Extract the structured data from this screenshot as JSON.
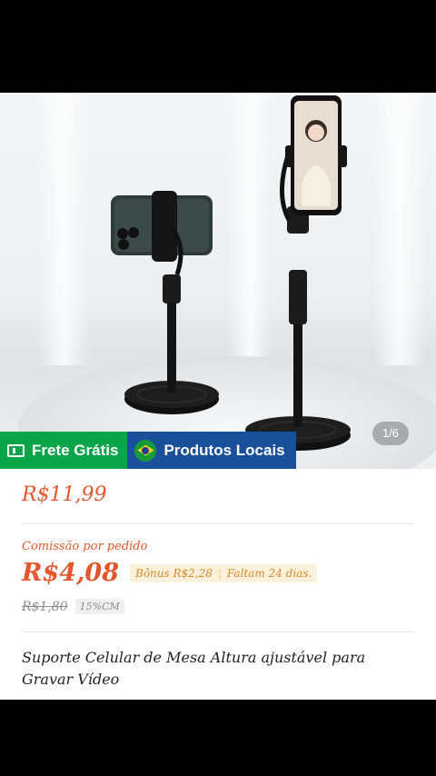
{
  "gallery": {
    "counter": "1/6"
  },
  "badges": {
    "free_shipping": "Frete Grátis",
    "local_products": "Produtos Locais"
  },
  "product": {
    "price": "R$11,99",
    "commission_label": "Comissão por pedido",
    "commission_value": "R$4,08",
    "bonus": "Bônus R$2,28",
    "remaining": "Faltam 24 dias.",
    "original_commission": "R$1,80",
    "commission_rate": "15%CM",
    "title": "Suporte Celular de Mesa Altura ajustável para Gravar Vídeo"
  },
  "colors": {
    "accent": "#e4572e",
    "free_badge": "#0aa54a",
    "local_badge": "#1a4f9a"
  }
}
